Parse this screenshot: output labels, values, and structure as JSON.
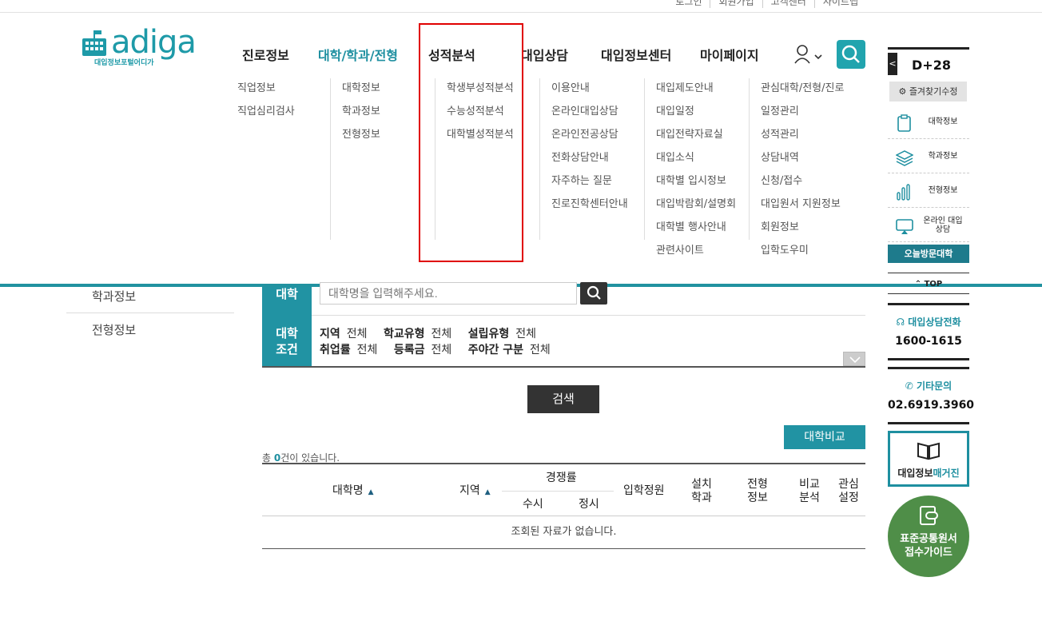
{
  "util_links": [
    "로그인",
    "회원가입",
    "고객센터",
    "사이트맵"
  ],
  "logo": {
    "word": "adiga",
    "sub": "대입정보포털어디가"
  },
  "gnb": [
    "진로정보",
    "대학/학과/전형",
    "성적분석",
    "대입상담",
    "대입정보센터",
    "마이페이지"
  ],
  "submenu": [
    [
      "직업정보",
      "직업심리검사"
    ],
    [
      "대학정보",
      "학과정보",
      "전형정보"
    ],
    [
      "학생부성적분석",
      "수능성적분석",
      "대학별성적분석"
    ],
    [
      "이용안내",
      "온라인대입상담",
      "온라인전공상담",
      "전화상담안내",
      "자주하는 질문",
      "진로진학센터안내"
    ],
    [
      "대입제도안내",
      "대입일정",
      "대입전략자료실",
      "대입소식",
      "대학별 입시정보",
      "대입박람회/설명회",
      "대학별 행사안내",
      "관련사이트"
    ],
    [
      "관심대학/전형/진로",
      "일정관리",
      "성적관리",
      "상담내역",
      "신청/접수",
      "대입원서 지원정보",
      "회원정보",
      "입학도우미"
    ]
  ],
  "left_nav": [
    "학과정보",
    "전형정보"
  ],
  "search": {
    "label_univ": "대학",
    "label_cond": "대학 조건",
    "placeholder": "대학명을 입력해주세요.",
    "row1": [
      {
        "k": "지역",
        "v": "전체"
      },
      {
        "k": "학교유형",
        "v": "전체"
      },
      {
        "k": "설립유형",
        "v": "전체"
      }
    ],
    "row2": [
      {
        "k": "취업률",
        "v": "전체"
      },
      {
        "k": "등록금",
        "v": "전체"
      },
      {
        "k": "주야간 구분",
        "v": "전체"
      }
    ],
    "button": "검색"
  },
  "compare_button": "대학비교",
  "count": {
    "prefix": "총 ",
    "n": "0",
    "suffix": "건이 있습니다."
  },
  "table": {
    "h_name": "대학명",
    "h_region": "지역",
    "h_comp": "경쟁률",
    "h_susi": "수시",
    "h_jungsi": "정시",
    "h_quota": "입학정원",
    "h_dept": "설치 학과",
    "h_adm": "전형 정보",
    "h_cmp": "비교 분석",
    "h_fav": "관심 설정",
    "empty": "조회된 자료가 없습니다."
  },
  "quick": {
    "dday": "D+28",
    "fav": "즐겨찾기수정",
    "items": [
      "대학정보",
      "학과정보",
      "전형정보",
      "온라인 대입상담"
    ],
    "today": "오늘방문대학",
    "top": "TOP",
    "call_label": "대입상담전화",
    "call_num": "1600-1615",
    "etc_label": "기타문의",
    "etc_num": "02.6919.3960",
    "mag_a": "대입정보",
    "mag_b": "매거진",
    "guide": "표준공통원서 접수가이드"
  }
}
